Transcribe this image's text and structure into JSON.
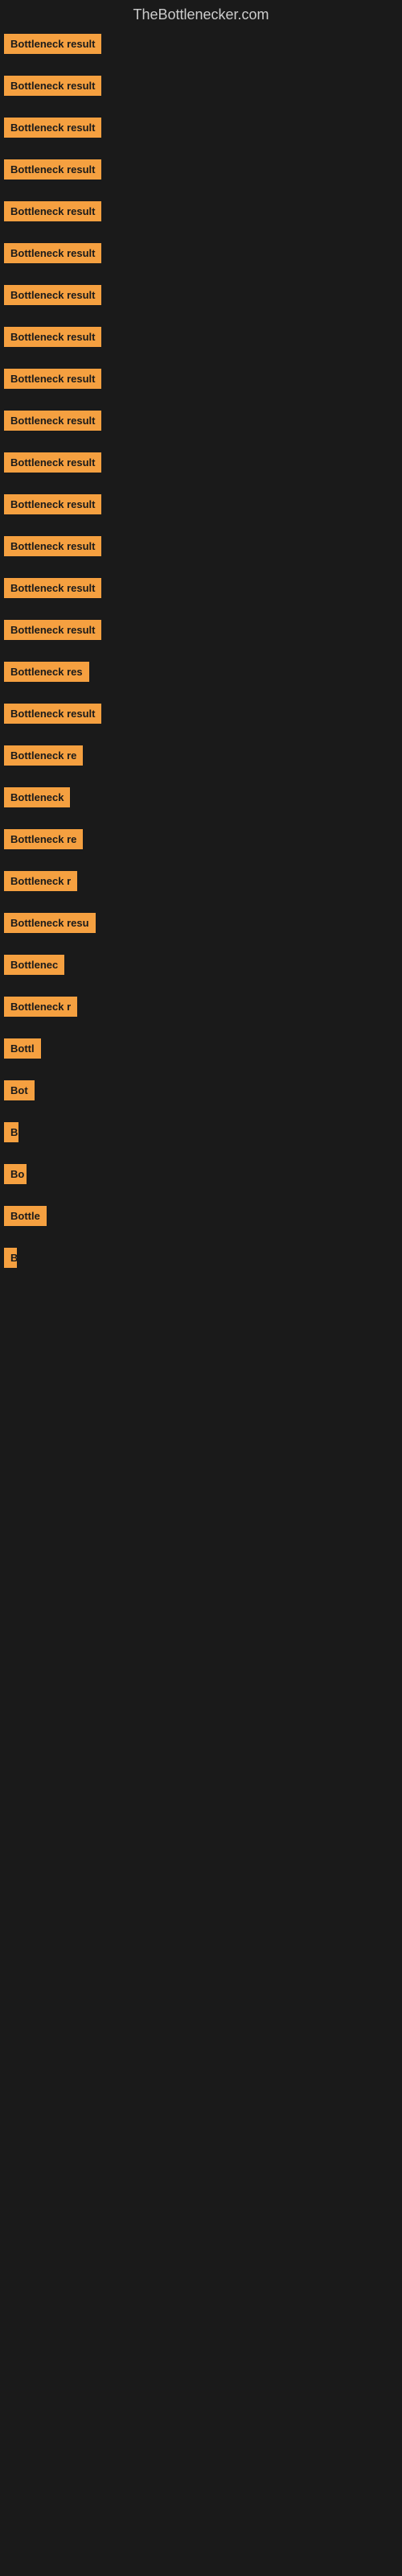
{
  "header": {
    "title": "TheBottlenecker.com"
  },
  "items": [
    {
      "label": "Bottleneck result",
      "width": 145,
      "spacer": 20
    },
    {
      "label": "Bottleneck result",
      "width": 145,
      "spacer": 20
    },
    {
      "label": "Bottleneck result",
      "width": 145,
      "spacer": 20
    },
    {
      "label": "Bottleneck result",
      "width": 145,
      "spacer": 20
    },
    {
      "label": "Bottleneck result",
      "width": 145,
      "spacer": 20
    },
    {
      "label": "Bottleneck result",
      "width": 145,
      "spacer": 20
    },
    {
      "label": "Bottleneck result",
      "width": 145,
      "spacer": 20
    },
    {
      "label": "Bottleneck result",
      "width": 145,
      "spacer": 20
    },
    {
      "label": "Bottleneck result",
      "width": 145,
      "spacer": 20
    },
    {
      "label": "Bottleneck result",
      "width": 145,
      "spacer": 20
    },
    {
      "label": "Bottleneck result",
      "width": 145,
      "spacer": 20
    },
    {
      "label": "Bottleneck result",
      "width": 145,
      "spacer": 20
    },
    {
      "label": "Bottleneck result",
      "width": 145,
      "spacer": 20
    },
    {
      "label": "Bottleneck result",
      "width": 145,
      "spacer": 20
    },
    {
      "label": "Bottleneck result",
      "width": 145,
      "spacer": 20
    },
    {
      "label": "Bottleneck res",
      "width": 115,
      "spacer": 20
    },
    {
      "label": "Bottleneck result",
      "width": 140,
      "spacer": 20
    },
    {
      "label": "Bottleneck re",
      "width": 108,
      "spacer": 20
    },
    {
      "label": "Bottleneck",
      "width": 88,
      "spacer": 20
    },
    {
      "label": "Bottleneck re",
      "width": 108,
      "spacer": 20
    },
    {
      "label": "Bottleneck r",
      "width": 100,
      "spacer": 20
    },
    {
      "label": "Bottleneck resu",
      "width": 118,
      "spacer": 20
    },
    {
      "label": "Bottlenec",
      "width": 82,
      "spacer": 20
    },
    {
      "label": "Bottleneck r",
      "width": 98,
      "spacer": 20
    },
    {
      "label": "Bottl",
      "width": 52,
      "spacer": 20
    },
    {
      "label": "Bot",
      "width": 40,
      "spacer": 20
    },
    {
      "label": "B",
      "width": 18,
      "spacer": 20
    },
    {
      "label": "Bo",
      "width": 28,
      "spacer": 20
    },
    {
      "label": "Bottle",
      "width": 55,
      "spacer": 20
    },
    {
      "label": "B",
      "width": 14,
      "spacer": 20
    }
  ],
  "colors": {
    "background": "#1a1a1a",
    "label_bg": "#f5a040",
    "label_text": "#1a1a1a",
    "header_text": "#cccccc"
  }
}
